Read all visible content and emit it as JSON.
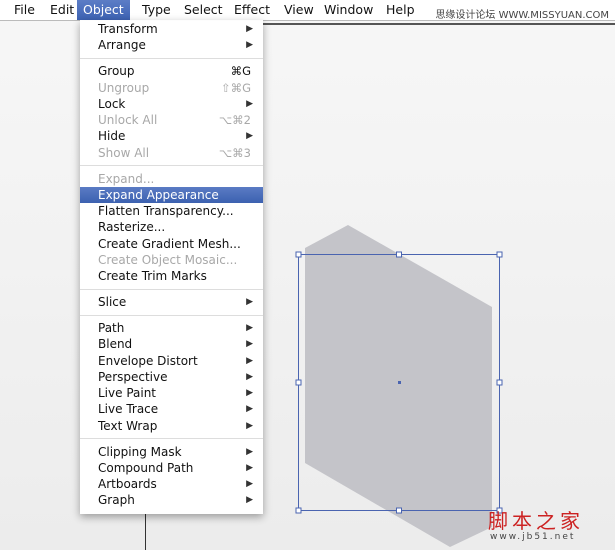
{
  "menubar": {
    "items": [
      "File",
      "Edit",
      "Object",
      "Type",
      "Select",
      "Effect",
      "View",
      "Window",
      "Help"
    ],
    "active": "Object"
  },
  "watermarks": {
    "top": "思缘设计论坛 WWW.MISSYUAN.COM",
    "bottom_cn": "脚本之家",
    "bottom_url": "www.jb51.net"
  },
  "menu": {
    "groups": [
      [
        {
          "label": "Transform",
          "submenu": true
        },
        {
          "label": "Arrange",
          "submenu": true
        }
      ],
      [
        {
          "label": "Group",
          "shortcut": "⌘G"
        },
        {
          "label": "Ungroup",
          "shortcut": "⇧⌘G",
          "disabled": true
        },
        {
          "label": "Lock",
          "submenu": true
        },
        {
          "label": "Unlock All",
          "shortcut": "⌥⌘2",
          "disabled": true
        },
        {
          "label": "Hide",
          "submenu": true
        },
        {
          "label": "Show All",
          "shortcut": "⌥⌘3",
          "disabled": true
        }
      ],
      [
        {
          "label": "Expand...",
          "disabled": true
        },
        {
          "label": "Expand Appearance",
          "highlighted": true
        },
        {
          "label": "Flatten Transparency..."
        },
        {
          "label": "Rasterize..."
        },
        {
          "label": "Create Gradient Mesh..."
        },
        {
          "label": "Create Object Mosaic...",
          "disabled": true
        },
        {
          "label": "Create Trim Marks"
        }
      ],
      [
        {
          "label": "Slice",
          "submenu": true
        }
      ],
      [
        {
          "label": "Path",
          "submenu": true
        },
        {
          "label": "Blend",
          "submenu": true
        },
        {
          "label": "Envelope Distort",
          "submenu": true
        },
        {
          "label": "Perspective",
          "submenu": true
        },
        {
          "label": "Live Paint",
          "submenu": true
        },
        {
          "label": "Live Trace",
          "submenu": true
        },
        {
          "label": "Text Wrap",
          "submenu": true
        }
      ],
      [
        {
          "label": "Clipping Mask",
          "submenu": true
        },
        {
          "label": "Compound Path",
          "submenu": true
        },
        {
          "label": "Artboards",
          "submenu": true
        },
        {
          "label": "Graph",
          "submenu": true
        }
      ]
    ]
  },
  "colors": {
    "shape_fill": "#c4c4c9",
    "selection": "#4a64b0",
    "highlight": "#3d62b3"
  }
}
